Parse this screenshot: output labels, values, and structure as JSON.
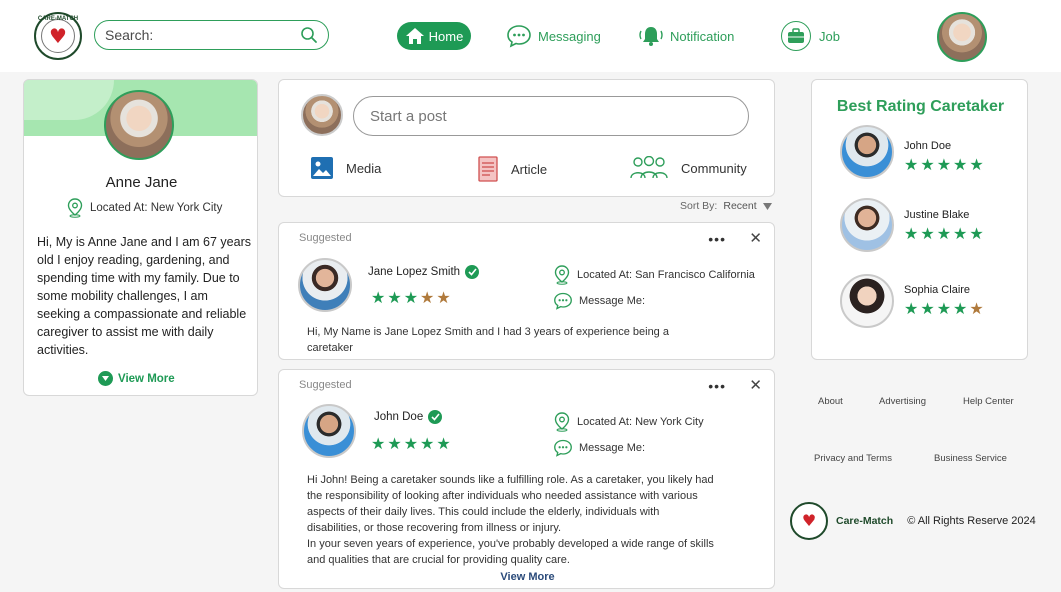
{
  "brand": {
    "logo_text": "CARE-MATCH",
    "name": "Care-Match",
    "copyright": "© All Rights Reserve 2024"
  },
  "search": {
    "placeholder": "Search:"
  },
  "nav": {
    "home": "Home",
    "messaging": "Messaging",
    "notification": "Notification",
    "job": "Job"
  },
  "profile": {
    "name": "Anne Jane",
    "location": "Located At: New York City",
    "bio": "Hi, My is Anne Jane and I am 67 years old I enjoy reading, gardening, and spending time with my family. Due to some mobility challenges, I am seeking a compassionate and reliable caregiver to assist me with daily activities.",
    "view_more": "View More"
  },
  "post": {
    "placeholder": "Start a  post",
    "media": "Media",
    "article": "Article",
    "community": "Community"
  },
  "sort": {
    "label": "Sort By:",
    "value": "Recent"
  },
  "suggestions": [
    {
      "label": "Suggested",
      "name": "Jane Lopez Smith",
      "rating": 4.5,
      "location": "Located At: San Francisco California",
      "message": "Message Me:",
      "text": "Hi, My Name is Jane Lopez Smith and I had 3 years of experience being a caretaker"
    },
    {
      "label": "Suggested",
      "name": "John Doe",
      "rating": 5,
      "location": "Located At: New York City",
      "message": "Message Me:",
      "text_lines": [
        "Hi John! Being a caretaker sounds like a fulfilling role. As a caretaker, you likely had",
        "the responsibility of looking after individuals who needed assistance with various",
        "aspects of their daily lives. This could include the elderly, individuals with",
        "disabilities, or those recovering from illness or injury.",
        "In your seven years of experience, you've probably developed a wide range of skills",
        "and qualities that are crucial for providing quality care."
      ],
      "view_more": "View More"
    }
  ],
  "rating": {
    "title": "Best Rating Caretaker",
    "people": [
      {
        "name": "John Doe",
        "rating": 5
      },
      {
        "name": "Justine Blake",
        "rating": 5
      },
      {
        "name": "Sophia Claire",
        "rating": 4.5
      }
    ]
  },
  "footer": {
    "about": "About",
    "advertising": "Advertising",
    "help": "Help Center",
    "privacy": "Privacy and Terms",
    "business": "Business Service"
  },
  "colors": {
    "accent": "#1e9a55",
    "banner": "#a6e6b0",
    "star_half": "#b07a3c"
  }
}
